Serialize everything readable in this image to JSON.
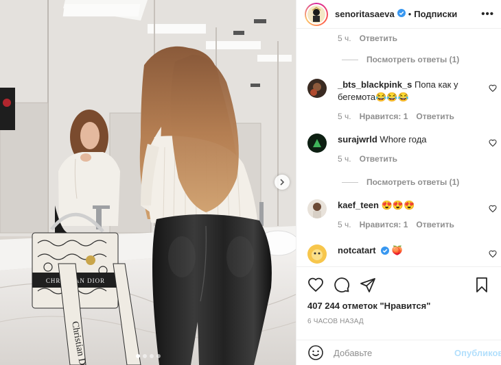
{
  "post": {
    "username": "senoritasaeva",
    "separator": "•",
    "follow_label": "Подписки",
    "more_label": "•••"
  },
  "media": {
    "slide_count": 4,
    "active_slide": 1
  },
  "comments": {
    "top_meta": {
      "time": "5 ч.",
      "reply": "Ответить"
    },
    "replies_1": "Посмотреть ответы (1)",
    "items": [
      {
        "user": "_bts_blackpink_s",
        "text": "Попа как у бегемота😂😂😂",
        "time": "5 ч.",
        "likes": "Нравится: 1",
        "reply": "Ответить"
      },
      {
        "user": "surajwrld",
        "text": "Whore года",
        "time": "5 ч.",
        "reply": "Ответить",
        "replies": "Посмотреть ответы (1)"
      },
      {
        "user": "kaef_teen",
        "text": "😍😍😍",
        "time": "5 ч.",
        "likes": "Нравится: 1",
        "reply": "Ответить"
      },
      {
        "user": "notcatart",
        "text": "🍑",
        "verified": true
      }
    ]
  },
  "actions": {
    "likes_text": "407 244 отметок \"Нравится\"",
    "time_ago": "6 часов назад"
  },
  "composer": {
    "placeholder": "Добавьте",
    "publish_label": "Опубликовать"
  },
  "colors": {
    "verified": "#3897f0",
    "publish_disabled": "#b2dffc",
    "secondary_text": "#8e8e8e"
  }
}
